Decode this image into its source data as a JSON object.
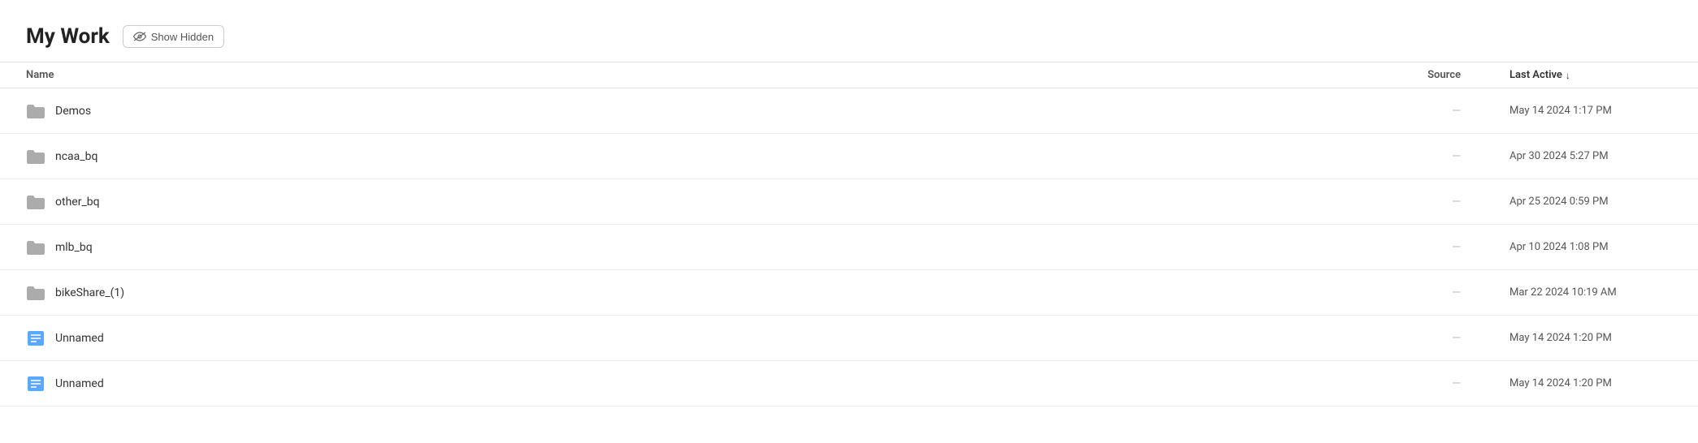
{
  "header": {
    "title": "My Work",
    "show_hidden_button": "Show Hidden"
  },
  "table": {
    "columns": {
      "name": "Name",
      "source": "Source",
      "last_active": "Last Active"
    },
    "rows": [
      {
        "id": 1,
        "type": "folder",
        "name": "Demos",
        "source": "—",
        "last_active": "May 14 2024 1:17 PM"
      },
      {
        "id": 2,
        "type": "folder",
        "name": "ncaa_bq",
        "source": "—",
        "last_active": "Apr 30 2024 5:27 PM"
      },
      {
        "id": 3,
        "type": "folder",
        "name": "other_bq",
        "source": "—",
        "last_active": "Apr 25 2024 0:59 PM"
      },
      {
        "id": 4,
        "type": "folder",
        "name": "mlb_bq",
        "source": "—",
        "last_active": "Apr 10 2024 1:08 PM"
      },
      {
        "id": 5,
        "type": "folder",
        "name": "bikeShare_(1)",
        "source": "—",
        "last_active": "Mar 22 2024 10:19 AM"
      },
      {
        "id": 6,
        "type": "notebook",
        "name": "Unnamed",
        "source": "—",
        "last_active": "May 14 2024 1:20 PM"
      },
      {
        "id": 7,
        "type": "notebook",
        "name": "Unnamed",
        "source": "—",
        "last_active": "May 14 2024 1:20 PM"
      }
    ]
  }
}
